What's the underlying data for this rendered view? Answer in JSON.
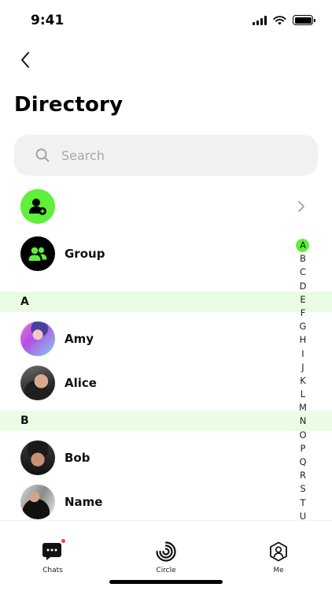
{
  "status_bar": {
    "time": "9:41"
  },
  "header": {
    "title": "Directory"
  },
  "search": {
    "placeholder": "Search"
  },
  "actions": {
    "group_label": "Group"
  },
  "sections": [
    {
      "letter": "A",
      "contacts": [
        "Amy",
        "Alice"
      ]
    },
    {
      "letter": "B",
      "contacts": [
        "Bob",
        "Name"
      ]
    }
  ],
  "alpha_index": [
    "A",
    "B",
    "C",
    "D",
    "E",
    "F",
    "G",
    "H",
    "I",
    "J",
    "K",
    "L",
    "M",
    "N",
    "O",
    "P",
    "Q",
    "R",
    "S",
    "T",
    "U"
  ],
  "alpha_active": "A",
  "tab_bar": {
    "chats_label": "Chats",
    "circle_label": "Circle",
    "me_label": "Me"
  },
  "colors": {
    "accent": "#5ef03a",
    "section_bg": "#eafde4",
    "badge": "#ff3b30"
  },
  "icons": [
    "back-arrow-icon",
    "search-icon",
    "add-user-icon",
    "group-icon",
    "chevron-right-icon",
    "chats-icon",
    "circle-icon",
    "me-icon"
  ]
}
